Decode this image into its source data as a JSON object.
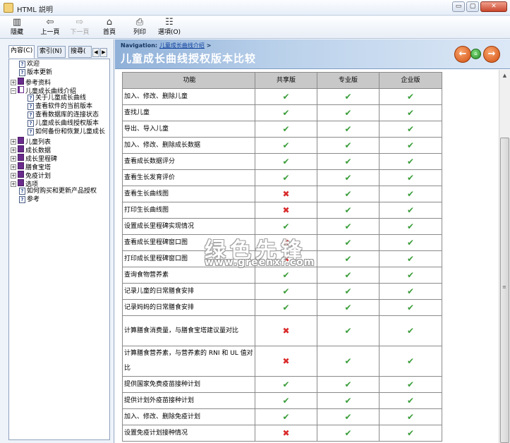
{
  "window": {
    "title": "HTML 説明",
    "min_glyph": "▭",
    "max_glyph": "▢",
    "close_glyph": "✕"
  },
  "toolbar": {
    "hide": {
      "label": "隱藏",
      "icon": "hide-icon",
      "glyph": "▥"
    },
    "back": {
      "label": "上一頁",
      "icon": "back-arrow-icon",
      "glyph": "⇦"
    },
    "forward": {
      "label": "下一頁",
      "icon": "forward-arrow-icon",
      "glyph": "⇨"
    },
    "home": {
      "label": "首頁",
      "icon": "home-icon",
      "glyph": "⌂"
    },
    "print": {
      "label": "列印",
      "icon": "printer-icon",
      "glyph": "⎙"
    },
    "options": {
      "label": "選項(O)",
      "icon": "options-icon",
      "glyph": "☷"
    }
  },
  "left_tabs": {
    "contents": "內容(C)",
    "index": "索引(N)",
    "search": "搜尋(",
    "arrow_left": "◀",
    "arrow_right": "▶"
  },
  "tree": {
    "items": [
      {
        "label": "欢迎",
        "icon": "page",
        "toggle": "",
        "depth": 0
      },
      {
        "label": "版本更新",
        "icon": "page",
        "toggle": "",
        "depth": 0
      },
      {
        "label": "参考资料",
        "icon": "book",
        "toggle": "+",
        "depth": 0
      },
      {
        "label": "儿童成长曲线介绍",
        "icon": "open-book",
        "toggle": "−",
        "depth": 0
      },
      {
        "label": "关于儿童成长曲线",
        "icon": "page",
        "toggle": "",
        "depth": 1
      },
      {
        "label": "查看软件的当前版本",
        "icon": "page",
        "toggle": "",
        "depth": 1
      },
      {
        "label": "查看数据库的连接状态",
        "icon": "page",
        "toggle": "",
        "depth": 1
      },
      {
        "label": "儿童成长曲线授权版本",
        "icon": "page",
        "toggle": "",
        "depth": 1
      },
      {
        "label": "如何备份和恢复儿童成长",
        "icon": "page",
        "toggle": "",
        "depth": 1
      },
      {
        "label": "儿童列表",
        "icon": "book",
        "toggle": "+",
        "depth": 0
      },
      {
        "label": "成长数据",
        "icon": "book",
        "toggle": "+",
        "depth": 0
      },
      {
        "label": "成长里程碑",
        "icon": "book",
        "toggle": "+",
        "depth": 0
      },
      {
        "label": "膳食宝塔",
        "icon": "book",
        "toggle": "+",
        "depth": 0
      },
      {
        "label": "免疫计划",
        "icon": "book",
        "toggle": "+",
        "depth": 0
      },
      {
        "label": "选项",
        "icon": "book",
        "toggle": "+",
        "depth": 0
      },
      {
        "label": "如何购买和更新产品授权",
        "icon": "page",
        "toggle": "",
        "depth": 0
      },
      {
        "label": "参考",
        "icon": "page",
        "toggle": "",
        "depth": 0
      }
    ]
  },
  "banner": {
    "nav_label": "Navigation:",
    "nav_link": "儿童成长曲线介绍",
    "nav_sep": ">",
    "title": "儿童成长曲线授权版本比较",
    "back_glyph": "←",
    "home_glyph": "⌂",
    "forward_glyph": "→"
  },
  "table": {
    "headers": [
      "功能",
      "共享版",
      "专业版",
      "企业版"
    ],
    "rows": [
      {
        "feature": "加入、修改、删除儿童",
        "marks": [
          true,
          true,
          true
        ]
      },
      {
        "feature": "查找儿童",
        "marks": [
          true,
          true,
          true
        ]
      },
      {
        "feature": "导出、导入儿童",
        "marks": [
          true,
          true,
          true
        ]
      },
      {
        "feature": "加入、修改、删除成长数据",
        "marks": [
          true,
          true,
          true
        ]
      },
      {
        "feature": "查看成长数据评分",
        "marks": [
          true,
          true,
          true
        ]
      },
      {
        "feature": "查看生长发育评价",
        "marks": [
          true,
          true,
          true
        ]
      },
      {
        "feature": "查看生长曲线图",
        "marks": [
          false,
          true,
          true
        ]
      },
      {
        "feature": "打印生长曲线图",
        "marks": [
          false,
          true,
          true
        ]
      },
      {
        "feature": "设置成长里程碑实现情况",
        "marks": [
          true,
          true,
          true
        ]
      },
      {
        "feature": "查看成长里程碑窗口图",
        "marks": [
          false,
          true,
          true
        ]
      },
      {
        "feature": "打印成长里程碑窗口图",
        "marks": [
          false,
          true,
          true
        ]
      },
      {
        "feature": "查询食物营养素",
        "marks": [
          true,
          true,
          true
        ]
      },
      {
        "feature": "记录儿童的日常膳食安排",
        "marks": [
          true,
          true,
          true
        ]
      },
      {
        "feature": "记录妈妈的日常膳食安排",
        "marks": [
          true,
          true,
          true
        ]
      },
      {
        "feature": "计算膳食消费量，与膳食宝塔建议量对比",
        "marks": [
          false,
          true,
          true
        ]
      },
      {
        "feature": "计算膳食营养素，与营养素的 RNI 和 UL 值对比",
        "marks": [
          false,
          true,
          true
        ]
      },
      {
        "feature": "提供国家免费疫苗接种计划",
        "marks": [
          true,
          true,
          true
        ]
      },
      {
        "feature": "提供计划外疫苗接种计划",
        "marks": [
          true,
          true,
          true
        ]
      },
      {
        "feature": "加入、修改、删除免疫计划",
        "marks": [
          true,
          true,
          true
        ]
      },
      {
        "feature": "设置免疫计划接种情况",
        "marks": [
          false,
          true,
          true
        ]
      }
    ],
    "yes_glyph": "✔",
    "no_glyph": "✖",
    "yes_color": "#3a9d3a",
    "no_color": "#d92b2b"
  },
  "watermark": {
    "text": "绿色先锋",
    "url": "www.greenxf.com"
  },
  "scrollbar": {
    "up_glyph": "▲",
    "grip_glyph": "≡"
  }
}
